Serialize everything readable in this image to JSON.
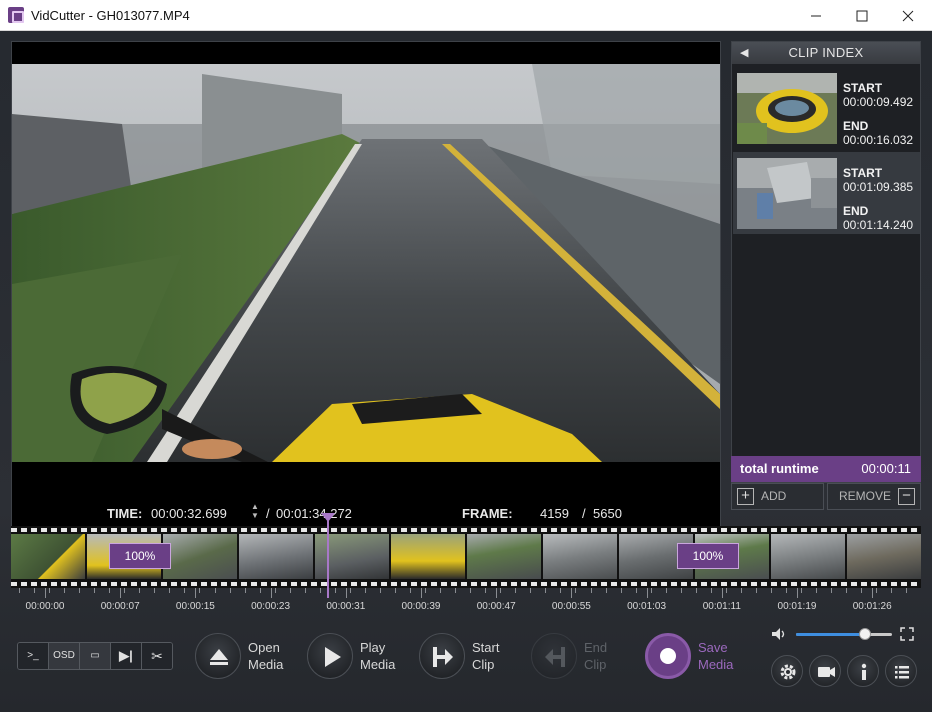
{
  "window": {
    "title": "VidCutter - GH013077.MP4",
    "minimize": "—",
    "maximize": "☐",
    "close": "✕"
  },
  "player": {
    "time_label": "TIME:",
    "current_time": "00:00:32.699",
    "separator": "/",
    "total_time": "00:01:34.272",
    "frame_label": "FRAME:",
    "current_frame": "4159",
    "frame_separator": "/",
    "total_frames": "5650"
  },
  "clip_index": {
    "header": "CLIP INDEX",
    "clips": [
      {
        "start_label": "START",
        "start": "00:00:09.492",
        "end_label": "END",
        "end": "00:00:16.032"
      },
      {
        "start_label": "START",
        "start": "00:01:09.385",
        "end_label": "END",
        "end": "00:01:14.240"
      }
    ],
    "runtime_label": "total runtime",
    "runtime": "00:00:11",
    "add_label": "ADD",
    "remove_label": "REMOVE"
  },
  "timeline": {
    "selections": [
      {
        "label": "100%"
      },
      {
        "label": "100%"
      }
    ],
    "ticks": [
      "00:00:00",
      "00:00:07",
      "00:00:15",
      "00:00:23",
      "00:00:31",
      "00:00:39",
      "00:00:47",
      "00:00:55",
      "00:01:03",
      "00:01:11",
      "00:01:19",
      "00:01:26"
    ]
  },
  "toolbar": {
    "console_label": ">_",
    "osd_label": "OSD",
    "open_media": [
      "Open",
      "Media"
    ],
    "play_media": [
      "Play",
      "Media"
    ],
    "start_clip": [
      "Start",
      "Clip"
    ],
    "end_clip": [
      "End",
      "Clip"
    ],
    "save_media": [
      "Save",
      "Media"
    ],
    "volume": 0.72,
    "icons": [
      "terminal-icon",
      "osd-icon",
      "subtitle-icon",
      "skip-end-icon",
      "scissors-icon",
      "eject-icon",
      "play-icon",
      "clip-start-icon",
      "clip-end-icon",
      "record-icon",
      "volume-icon",
      "fullscreen-icon",
      "gear-icon",
      "camera-icon",
      "info-icon",
      "list-icon"
    ]
  },
  "colors": {
    "accent": "#6a3f86",
    "selection_border": "#c9a5dd",
    "playhead": "#a878c8",
    "volume_fill": "#3e8ee0"
  }
}
